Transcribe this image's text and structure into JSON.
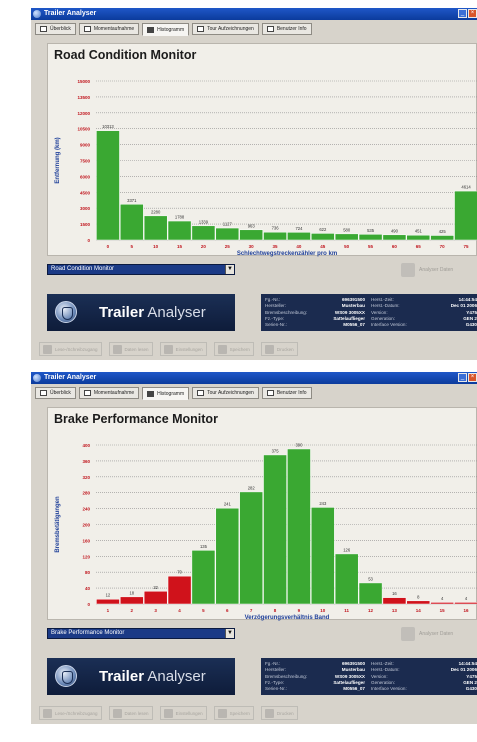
{
  "app": {
    "title": "Trailer Analyser",
    "window_buttons": {
      "minimize": "_",
      "close": "×"
    },
    "tabs": [
      {
        "label": "Überblick",
        "active": false
      },
      {
        "label": "Momentaufnahme",
        "active": false
      },
      {
        "label": "Histogramm",
        "active": true
      },
      {
        "label": "Tour Aufzeichnungen",
        "active": false
      },
      {
        "label": "Benutzer Info",
        "active": false
      }
    ],
    "brand_bold": "Trailer",
    "brand_light": " Analyser",
    "info": {
      "labels_left": [
        "Fg.-Nr.:",
        "Hersteller:",
        "Bremsbeschreibung:",
        "Fz.-Type:",
        "Serien-Nr.:"
      ],
      "values_left": [
        "696391500",
        "Musterbau",
        "WS09 3005XX",
        "Sattelauflieger",
        "M0556_07"
      ],
      "labels_right": [
        "Herst.-Zeit:",
        "Herst.-Datum:",
        "Version:",
        "Generation:",
        "Interface Version:"
      ],
      "values_right": [
        "14:44:54",
        "Dec 01 2006",
        "Y475",
        "GEN 2",
        "G430"
      ]
    },
    "faded_button": "Analyser Daten",
    "toolbar": [
      "Lese-/Schreibzugang",
      "Daten lesen",
      "Einstellungen",
      "Speichern",
      "Drucken"
    ],
    "arrow": "▼",
    "colors": {
      "bar_green": "#3aa832",
      "bar_red": "#d0121b",
      "axis_label": "#c0141c",
      "header_blue": "#1b3a86"
    }
  },
  "screens": [
    {
      "panel_title": "Road Condition Monitor",
      "select_value": "Road Condition Monitor",
      "chart_data": {
        "type": "bar",
        "title": "Road Condition Monitor",
        "xlabel": "Schlechtwegstreckenzähler pro km",
        "ylabel": "Entfernung (km)",
        "ylim": [
          0,
          15000
        ],
        "yticks": [
          0,
          1500,
          3000,
          4500,
          6000,
          7500,
          9000,
          10500,
          12000,
          13500,
          15000
        ],
        "categories": [
          "0",
          "5",
          "10",
          "15",
          "20",
          "25",
          "30",
          "35",
          "40",
          "45",
          "50",
          "55",
          "60",
          "65",
          "70",
          "75"
        ],
        "values": [
          10313,
          3371,
          2280,
          1788,
          1339,
          1127,
          963,
          736,
          724,
          622,
          580,
          535,
          490,
          451,
          425,
          4614
        ],
        "data_labels": [
          "10313",
          "3371",
          "2280",
          "1788",
          "1339",
          "1127",
          "963",
          "736",
          "724",
          "622",
          "580",
          "535",
          "490",
          "451",
          "425",
          "4614"
        ],
        "colors": [
          "green",
          "green",
          "green",
          "green",
          "green",
          "green",
          "green",
          "green",
          "green",
          "green",
          "green",
          "green",
          "green",
          "green",
          "green",
          "green"
        ],
        "grid": true
      }
    },
    {
      "panel_title": "Brake Performance Monitor",
      "select_value": "Brake Performance Monitor",
      "chart_data": {
        "type": "bar",
        "title": "Brake Performance Monitor",
        "xlabel": "Verzögerungsverhältnis Band",
        "ylabel": "Bremsbetätigungen",
        "ylim": [
          0,
          400
        ],
        "yticks": [
          0,
          40,
          80,
          120,
          160,
          200,
          240,
          280,
          320,
          360,
          400
        ],
        "categories": [
          "1",
          "2",
          "3",
          "4",
          "5",
          "6",
          "7",
          "8",
          "9",
          "10",
          "11",
          "12",
          "13",
          "14",
          "15",
          "16"
        ],
        "values": [
          12,
          18,
          32,
          70,
          135,
          241,
          282,
          375,
          390,
          243,
          126,
          53,
          16,
          8,
          4,
          4
        ],
        "data_labels": [
          "12",
          "18",
          "32",
          "70",
          "135",
          "241",
          "282",
          "375",
          "390",
          "243",
          "126",
          "53",
          "16",
          "8",
          "4",
          "4"
        ],
        "colors": [
          "red",
          "red",
          "red",
          "red",
          "green",
          "green",
          "green",
          "green",
          "green",
          "green",
          "green",
          "green",
          "red",
          "red",
          "red",
          "red"
        ],
        "grid": true
      }
    }
  ]
}
